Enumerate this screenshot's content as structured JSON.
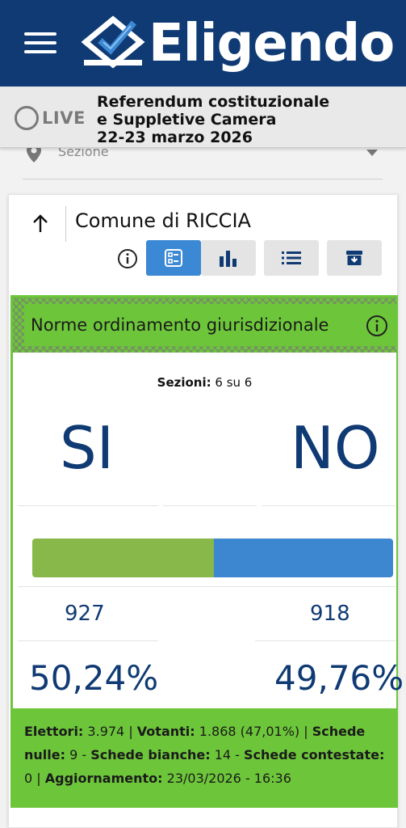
{
  "header": {
    "brand": "Eligendo",
    "brand_color": "#0f3a73"
  },
  "live": {
    "label": "LIVE",
    "title_line1": "Referendum costituzionale",
    "title_line2": "e Suppletive Camera",
    "title_line3": "22-23 marzo 2026"
  },
  "filter": {
    "sezione_placeholder": "Sezione"
  },
  "comune": {
    "title": "Comune di RICCIA"
  },
  "results": {
    "title": "Norme ordinamento giurisdizionale",
    "sezioni_label": "Sezioni:",
    "sezioni_value": "6 su 6",
    "si_label": "SI",
    "no_label": "NO",
    "si_votes": "927",
    "no_votes": "918",
    "si_pct": "50,24%",
    "no_pct": "49,76%",
    "si_fraction": 0.5024,
    "si_color": "#88b74a",
    "no_color": "#3d86d0",
    "accent_color": "#6dc63a"
  },
  "footer": {
    "elettori_label": "Elettori:",
    "elettori_value": "3.974",
    "votanti_label": "Votanti:",
    "votanti_value": "1.868 (47,01%)",
    "nulle_label": "Schede nulle:",
    "nulle_value": "9",
    "bianche_label": "Schede bianche:",
    "bianche_value": "14",
    "contestate_label": "Schede contestate:",
    "contestate_value": "0",
    "aggiornamento_label": "Aggiornamento:",
    "aggiornamento_value": "23/03/2026 - 16:36"
  }
}
